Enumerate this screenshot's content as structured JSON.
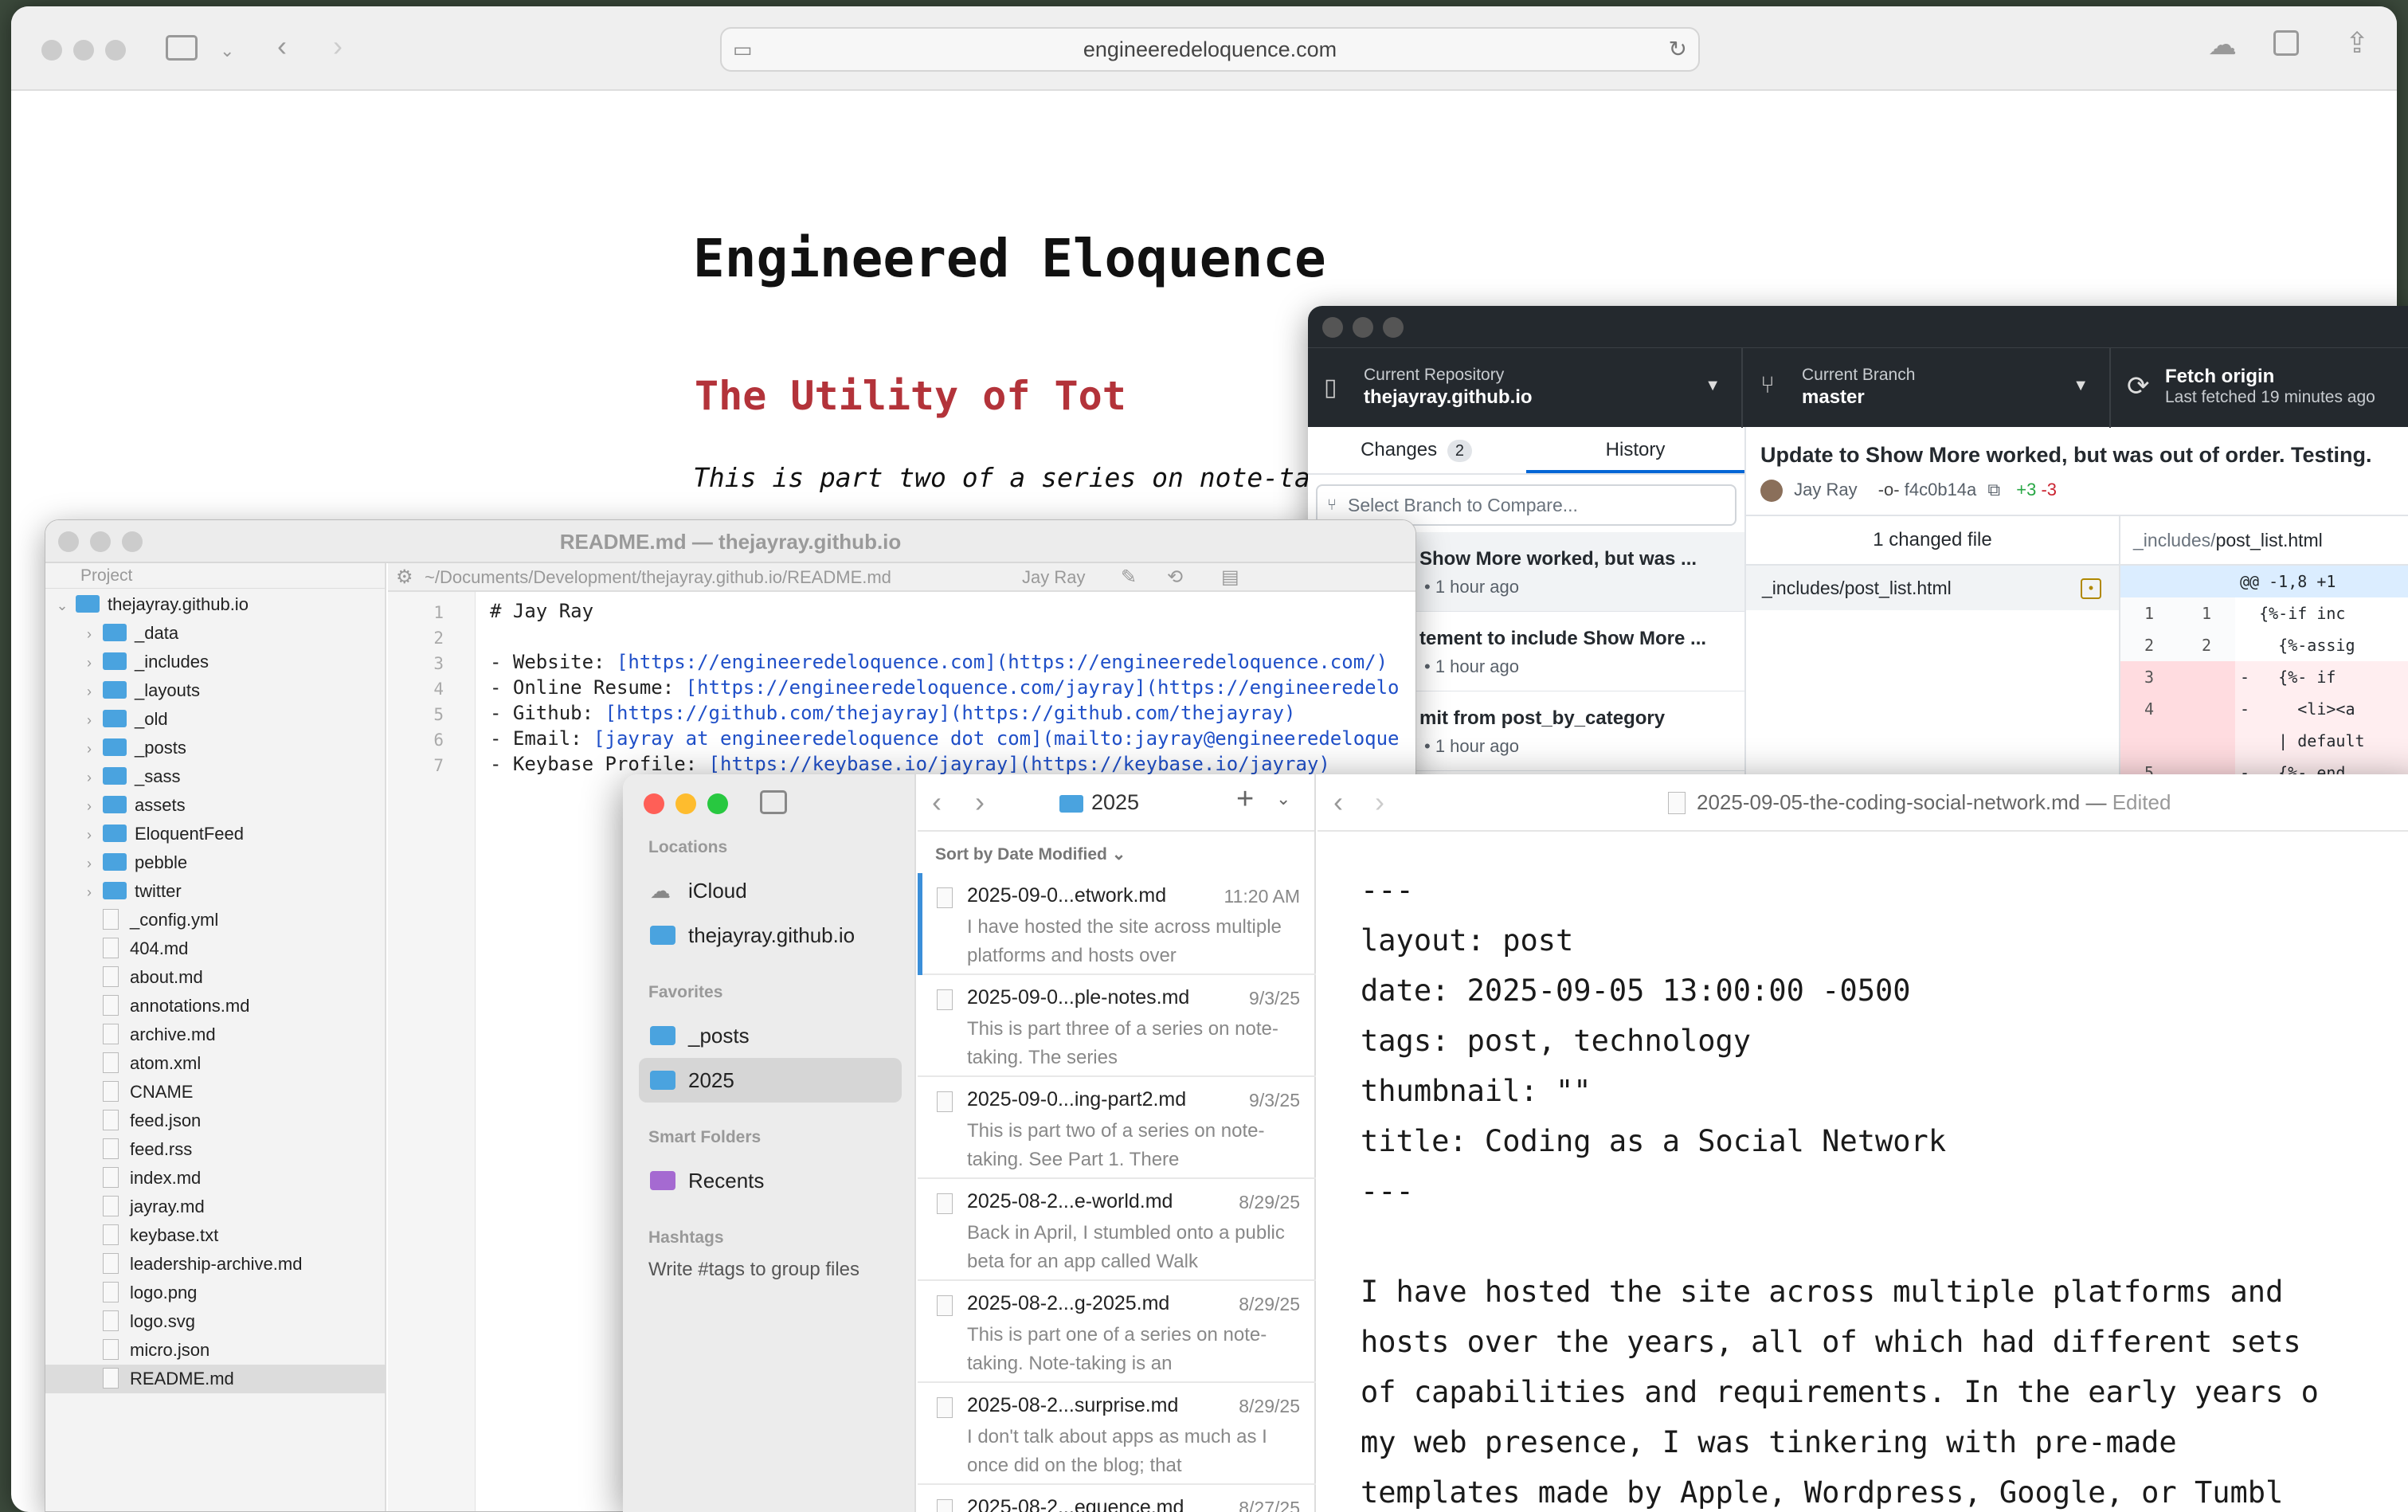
{
  "safari": {
    "url": "engineeredeloquence.com",
    "blog_title": "Engineered Eloquence",
    "post_title": "The Utility of Tot",
    "post_intro": "This is part two of a series on note-tak"
  },
  "editor": {
    "window_title": "README.md — thejayray.github.io",
    "project_label": "Project",
    "path": "~/Documents/Development/thejayray.github.io/README.md",
    "author": "Jay Ray",
    "tree": [
      {
        "label": "thejayray.github.io",
        "type": "folder",
        "depth": 0
      },
      {
        "label": "_data",
        "type": "folder",
        "depth": 1
      },
      {
        "label": "_includes",
        "type": "folder",
        "depth": 1
      },
      {
        "label": "_layouts",
        "type": "folder",
        "depth": 1
      },
      {
        "label": "_old",
        "type": "folder",
        "depth": 1
      },
      {
        "label": "_posts",
        "type": "folder",
        "depth": 1
      },
      {
        "label": "_sass",
        "type": "folder",
        "depth": 1
      },
      {
        "label": "assets",
        "type": "folder",
        "depth": 1
      },
      {
        "label": "EloquentFeed",
        "type": "folder",
        "depth": 1
      },
      {
        "label": "pebble",
        "type": "folder",
        "depth": 1
      },
      {
        "label": "twitter",
        "type": "folder",
        "depth": 1
      },
      {
        "label": "_config.yml",
        "type": "file",
        "depth": 1
      },
      {
        "label": "404.md",
        "type": "file",
        "depth": 1
      },
      {
        "label": "about.md",
        "type": "file",
        "depth": 1
      },
      {
        "label": "annotations.md",
        "type": "file",
        "depth": 1
      },
      {
        "label": "archive.md",
        "type": "file",
        "depth": 1
      },
      {
        "label": "atom.xml",
        "type": "file",
        "depth": 1
      },
      {
        "label": "CNAME",
        "type": "file",
        "depth": 1
      },
      {
        "label": "feed.json",
        "type": "file",
        "depth": 1
      },
      {
        "label": "feed.rss",
        "type": "file",
        "depth": 1
      },
      {
        "label": "index.md",
        "type": "file",
        "depth": 1
      },
      {
        "label": "jayray.md",
        "type": "file",
        "depth": 1
      },
      {
        "label": "keybase.txt",
        "type": "file",
        "depth": 1
      },
      {
        "label": "leadership-archive.md",
        "type": "file",
        "depth": 1
      },
      {
        "label": "logo.png",
        "type": "file",
        "depth": 1
      },
      {
        "label": "logo.svg",
        "type": "file",
        "depth": 1
      },
      {
        "label": "micro.json",
        "type": "file",
        "depth": 1
      },
      {
        "label": "README.md",
        "type": "file",
        "depth": 1,
        "selected": true
      }
    ],
    "lines": [
      {
        "n": "1",
        "a": "# Jay Ray",
        "b": ""
      },
      {
        "n": "2",
        "a": "",
        "b": ""
      },
      {
        "n": "3",
        "a": "- Website: ",
        "b": "[https://engineeredeloquence.com](https://engineeredeloquence.com/)"
      },
      {
        "n": "4",
        "a": "- Online Resume: ",
        "b": "[https://engineeredeloquence.com/jayray](https://engineeredelo"
      },
      {
        "n": "5",
        "a": "- Github: ",
        "b": "[https://github.com/thejayray](https://github.com/thejayray)"
      },
      {
        "n": "6",
        "a": "- Email: ",
        "b": "[jayray at engineeredeloquence dot com](mailto:jayray@engineeredeloque"
      },
      {
        "n": "7",
        "a": "- Keybase Profile: ",
        "b": "[https://keybase.io/jayray](https://keybase.io/jayray)"
      }
    ]
  },
  "github": {
    "repo_label": "Current Repository",
    "repo": "thejayray.github.io",
    "branch_label": "Current Branch",
    "branch": "master",
    "fetch_label": "Fetch origin",
    "fetch_sub": "Last fetched 19 minutes ago",
    "tab_changes": "Changes",
    "changes_count": "2",
    "tab_history": "History",
    "branch_compare_placeholder": "Select Branch to Compare...",
    "commits": [
      {
        "title": "Show More worked, but was ...",
        "time": "1 hour ago"
      },
      {
        "title": "tement to include Show More ...",
        "time": "1 hour ago"
      },
      {
        "title": "mit from post_by_category",
        "time": "1 hour ago"
      }
    ],
    "commit_title": "Update to Show More worked, but was out of order. Testing.",
    "author": "Jay Ray",
    "sha": "f4c0b14a",
    "additions": "+3",
    "deletions": "-3",
    "changed_files": "1 changed file",
    "file": "_includes/post_list.html",
    "diff_dir": "_includes/",
    "diff_file": "post_list.html",
    "diff": [
      {
        "o": "",
        "n": "",
        "t": "@@ -1,8 +1",
        "k": "hunk"
      },
      {
        "o": "1",
        "n": "1",
        "t": "  {%-if inc",
        "k": "ctx"
      },
      {
        "o": "2",
        "n": "2",
        "t": "    {%-assig",
        "k": "ctx"
      },
      {
        "o": "3",
        "n": "",
        "t": "-   {%- if ",
        "k": "del"
      },
      {
        "o": "4",
        "n": "",
        "t": "-     <li><a",
        "k": "del"
      },
      {
        "o": "",
        "n": "",
        "t": "    | default",
        "k": "del"
      },
      {
        "o": "5",
        "n": "",
        "t": "-   {%- end",
        "k": "del"
      }
    ]
  },
  "notes": {
    "locations_label": "Locations",
    "icloud": "iCloud",
    "repo_folder": "thejayray.github.io",
    "favorites_label": "Favorites",
    "fav_posts": "_posts",
    "fav_2025": "2025",
    "smart_label": "Smart Folders",
    "recents": "Recents",
    "hashtags_label": "Hashtags",
    "hashtags_hint": "Write #tags to group files",
    "folder": "2025",
    "sort": "Sort by Date Modified",
    "doc_title": "2025-09-05-the-coding-social-network.md",
    "doc_status": "Edited",
    "items": [
      {
        "title": "2025-09-0...etwork.md",
        "date": "11:20 AM",
        "body": "I have hosted the site across multiple platforms and hosts over"
      },
      {
        "title": "2025-09-0...ple-notes.md",
        "date": "9/3/25",
        "body": "This is part three of a series on note-taking. The series"
      },
      {
        "title": "2025-09-0...ing-part2.md",
        "date": "9/3/25",
        "body": "This is part two of a series on note-taking. See Part 1. There"
      },
      {
        "title": "2025-08-2...e-world.md",
        "date": "8/29/25",
        "body": "Back in April, I stumbled onto a public beta for an app called Walk"
      },
      {
        "title": "2025-08-2...g-2025.md",
        "date": "8/29/25",
        "body": "This is part one of a series on note-taking. Note-taking is an"
      },
      {
        "title": "2025-08-2...surprise.md",
        "date": "8/29/25",
        "body": "I don't talk about apps as much as I once did on the blog; that"
      },
      {
        "title": "2025-08-2...equence.md",
        "date": "8/27/25",
        "body": ""
      }
    ],
    "md_lines": [
      "---",
      "layout: post",
      "date: 2025-09-05 13:00:00 -0500",
      "tags: post, technology",
      "thumbnail: \"\"",
      "title: Coding as a Social Network",
      "---",
      "",
      "I have hosted the site across multiple platforms and",
      "hosts over the years, all of which had different sets",
      "of capabilities and requirements. In the early years o",
      "my web presence, I was tinkering with pre-made",
      "templates made by Apple, Wordpress, Google, or Tumbl"
    ]
  }
}
